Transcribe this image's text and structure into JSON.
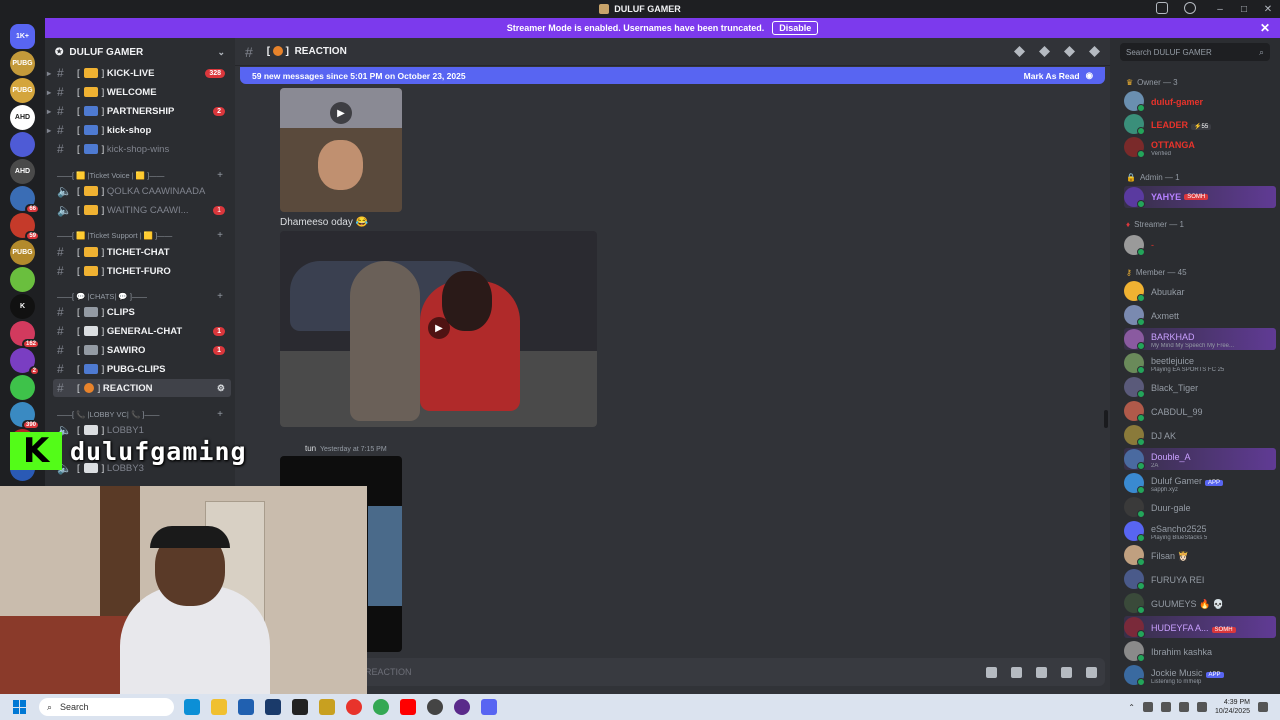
{
  "window": {
    "title": "DULUF GAMER"
  },
  "streamer_bar": {
    "text": "Streamer Mode is enabled. Usernames have been truncated.",
    "disable_label": "Disable",
    "close": "✕"
  },
  "server": {
    "name": "DULUF GAMER",
    "chevron": "⌄"
  },
  "server_rail": [
    {
      "label": "1K+",
      "color": "#5865f2",
      "badge": ""
    },
    {
      "label": "PUBG",
      "color": "#c49a3a",
      "badge": ""
    },
    {
      "label": "PUBG",
      "color": "#d4a53c",
      "badge": ""
    },
    {
      "label": "AHD",
      "color": "#ffffff",
      "badge": ""
    },
    {
      "label": "",
      "color": "#4e5bd6",
      "badge": ""
    },
    {
      "label": "AHD",
      "color": "#4a4a4a",
      "badge": ""
    },
    {
      "label": "",
      "color": "#3a6db5",
      "badge": "66"
    },
    {
      "label": "",
      "color": "#c53a2a",
      "badge": "59"
    },
    {
      "label": "PUBG",
      "color": "#b38a2c",
      "badge": ""
    },
    {
      "label": "",
      "color": "#6abf3e",
      "badge": ""
    },
    {
      "label": "K",
      "color": "#111111",
      "badge": ""
    },
    {
      "label": "",
      "color": "#d23a5e",
      "badge": "162"
    },
    {
      "label": "",
      "color": "#7a3ec2",
      "badge": "2"
    },
    {
      "label": "",
      "color": "#3ec24a",
      "badge": ""
    },
    {
      "label": "",
      "color": "#3a8ac2",
      "badge": "390"
    },
    {
      "label": "",
      "color": "#b5252a",
      "badge": ""
    },
    {
      "label": "ALT",
      "color": "#2a5ab5",
      "badge": ""
    }
  ],
  "channels": {
    "kick_live": {
      "name": "KICK-LIVE",
      "count": "328"
    },
    "welcome": {
      "name": "WELCOME"
    },
    "partnership": {
      "name": "PARTNERSHIP",
      "count": "2"
    },
    "kick_shop": {
      "name": "kick-shop"
    },
    "kick_shop_wins": {
      "name": "kick-shop-wins"
    },
    "cat_ticket_voice": "——[ 🟨 |Ticket Voice | 🟨 ]——",
    "qolka": {
      "name": "QOLKA CAAWINAADA"
    },
    "waiting": {
      "name": "WAITING CAAWI...",
      "count": "1"
    },
    "cat_ticket_support": "——[ 🟨 |Ticket Support | 🟨 ]——",
    "ticket_chat": {
      "name": "TICHET-CHAT"
    },
    "ticket_furo": {
      "name": "TICHET-FURO"
    },
    "cat_chats": "——[ 💬 |CHATS| 💬 ]——",
    "clips": {
      "name": "CLIPS"
    },
    "general_chat": {
      "name": "GENERAL-CHAT",
      "count": "1"
    },
    "sawiro": {
      "name": "SAWIRO",
      "count": "1"
    },
    "pubg_clips": {
      "name": "PUBG-CLIPS"
    },
    "reaction": {
      "name": "REACTION"
    },
    "cat_lobby": "——[ 📞 |LOBBY VC| 📞 ]——",
    "lobby1": {
      "name": "LOBBY1"
    },
    "lobby3": {
      "name": "LOBBY3"
    }
  },
  "chat": {
    "channel_title": "REACTION",
    "new_messages": "59 new messages since 5:01 PM on October 23, 2025",
    "mark_as_read": "Mark As Read",
    "caption": "Dhameeso oday 😂",
    "meta_name": "tun",
    "meta_time": "Yesterday at 7:15 PM",
    "input_placeholder": "REACTION"
  },
  "members": {
    "search_placeholder": "Search DULUF GAMER",
    "owner_group": "Owner — 3",
    "admin_group": "Admin — 1",
    "streamer_group": "Streamer — 1",
    "member_group": "Member — 45",
    "owners": [
      {
        "name": "duluf-gamer",
        "sub": "",
        "color": "#e8332b",
        "av": "#6a8fb0",
        "tag": ""
      },
      {
        "name": "LEADER",
        "sub": "",
        "color": "#e8332b",
        "av": "#3a8f7a",
        "tag": "⚡55"
      },
      {
        "name": "OTTANGA",
        "sub": "Verified",
        "color": "#e8332b",
        "av": "#7a2a2a",
        "tag": ""
      }
    ],
    "admin": {
      "name": "YAHYE",
      "tag": "SOMH",
      "av": "#5a3aa0"
    },
    "streamer": {
      "name": "-",
      "av": "#9a9a9a"
    },
    "list": [
      {
        "name": "Abuukar",
        "sub": "",
        "av": "#f0b232",
        "tag": "",
        "hl": false
      },
      {
        "name": "Axmett",
        "sub": "",
        "av": "#7a8ab0",
        "tag": "",
        "hl": false
      },
      {
        "name": "BARKHAD",
        "sub": "My Mind My Speech My Free...",
        "av": "#8a5aa0",
        "tag": "",
        "hl": true
      },
      {
        "name": "beetlejuice",
        "sub": "Playing EA SPORTS FC 25",
        "av": "#6a8a5a",
        "tag": "",
        "hl": false
      },
      {
        "name": "Black_Tiger",
        "sub": "",
        "av": "#5a5a7a",
        "tag": "",
        "hl": false
      },
      {
        "name": "CABDUL_99",
        "sub": "",
        "av": "#b05a4a",
        "tag": "",
        "hl": false
      },
      {
        "name": "DJ AK",
        "sub": "",
        "av": "#8a7a3a",
        "tag": "",
        "hl": false
      },
      {
        "name": "Double_A",
        "sub": "2A",
        "av": "#4a6aa0",
        "tag": "",
        "hl": true
      },
      {
        "name": "Duluf Gamer",
        "sub": "sapph.xyz",
        "av": "#3a8ad0",
        "tag": "APP",
        "hl": false
      },
      {
        "name": "Duur-gale",
        "sub": "",
        "av": "#3a3a3a",
        "tag": "",
        "hl": false
      },
      {
        "name": "eSancho2525",
        "sub": "Playing BlueStacks 5",
        "av": "#5865f2",
        "tag": "",
        "hl": false
      },
      {
        "name": "Filsan 👸🏻",
        "sub": "",
        "av": "#c0a080",
        "tag": "",
        "hl": false
      },
      {
        "name": "FURUYA REI",
        "sub": "",
        "av": "#4a5a8a",
        "tag": "",
        "hl": false
      },
      {
        "name": "GUUMEYS 🔥 💀",
        "sub": "",
        "av": "#3a4a3a",
        "tag": "",
        "hl": false
      },
      {
        "name": "HUDEYFA A...",
        "sub": "",
        "av": "#7a2a3a",
        "tag": "SOMH",
        "hl": true
      },
      {
        "name": "Ibrahim kashka",
        "sub": "",
        "av": "#8a8a8a",
        "tag": "",
        "hl": false
      },
      {
        "name": "Jockie Music",
        "sub": "Listening to m!help",
        "av": "#3a6aa0",
        "tag": "APP",
        "hl": false
      }
    ]
  },
  "overlay": {
    "kick_letter": "K",
    "streamer_name": "dulufgaming"
  },
  "taskbar": {
    "search_placeholder": "Search",
    "time": "4:39 PM",
    "date": "10/24/2025"
  }
}
